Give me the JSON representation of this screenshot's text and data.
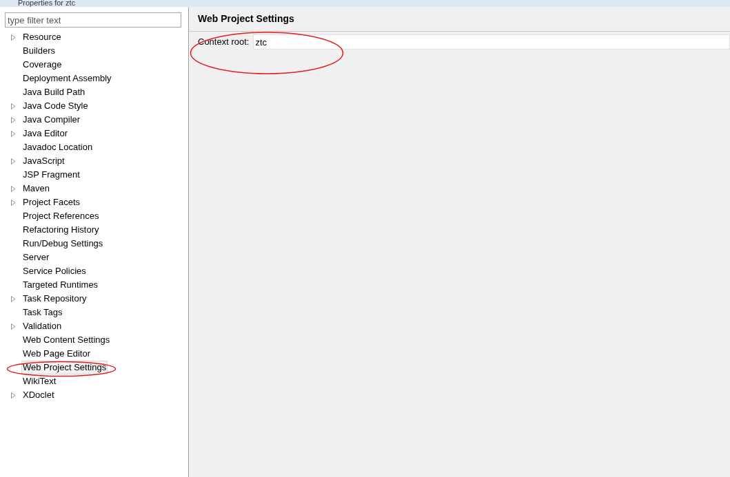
{
  "window": {
    "title": "Properties for ztc"
  },
  "filter": {
    "placeholder": "type filter text"
  },
  "tree": [
    {
      "label": "Resource",
      "kind": "branch",
      "selected": false
    },
    {
      "label": "Builders",
      "kind": "leaf",
      "selected": false
    },
    {
      "label": "Coverage",
      "kind": "leaf",
      "selected": false
    },
    {
      "label": "Deployment Assembly",
      "kind": "leaf",
      "selected": false
    },
    {
      "label": "Java Build Path",
      "kind": "leaf",
      "selected": false
    },
    {
      "label": "Java Code Style",
      "kind": "branch",
      "selected": false
    },
    {
      "label": "Java Compiler",
      "kind": "branch",
      "selected": false
    },
    {
      "label": "Java Editor",
      "kind": "branch",
      "selected": false
    },
    {
      "label": "Javadoc Location",
      "kind": "leaf",
      "selected": false
    },
    {
      "label": "JavaScript",
      "kind": "branch",
      "selected": false
    },
    {
      "label": "JSP Fragment",
      "kind": "leaf",
      "selected": false
    },
    {
      "label": "Maven",
      "kind": "branch",
      "selected": false
    },
    {
      "label": "Project Facets",
      "kind": "branch",
      "selected": false
    },
    {
      "label": "Project References",
      "kind": "leaf",
      "selected": false
    },
    {
      "label": "Refactoring History",
      "kind": "leaf",
      "selected": false
    },
    {
      "label": "Run/Debug Settings",
      "kind": "leaf",
      "selected": false
    },
    {
      "label": "Server",
      "kind": "leaf",
      "selected": false
    },
    {
      "label": "Service Policies",
      "kind": "leaf",
      "selected": false
    },
    {
      "label": "Targeted Runtimes",
      "kind": "leaf",
      "selected": false
    },
    {
      "label": "Task Repository",
      "kind": "branch",
      "selected": false
    },
    {
      "label": "Task Tags",
      "kind": "leaf",
      "selected": false
    },
    {
      "label": "Validation",
      "kind": "branch",
      "selected": false
    },
    {
      "label": "Web Content Settings",
      "kind": "leaf",
      "selected": false
    },
    {
      "label": "Web Page Editor",
      "kind": "leaf",
      "selected": false
    },
    {
      "label": "Web Project Settings",
      "kind": "leaf",
      "selected": true
    },
    {
      "label": "WikiText",
      "kind": "leaf",
      "selected": false
    },
    {
      "label": "XDoclet",
      "kind": "branch",
      "selected": false
    }
  ],
  "page": {
    "title": "Web Project Settings",
    "field": {
      "label": "Context root:",
      "value": "ztc"
    }
  }
}
